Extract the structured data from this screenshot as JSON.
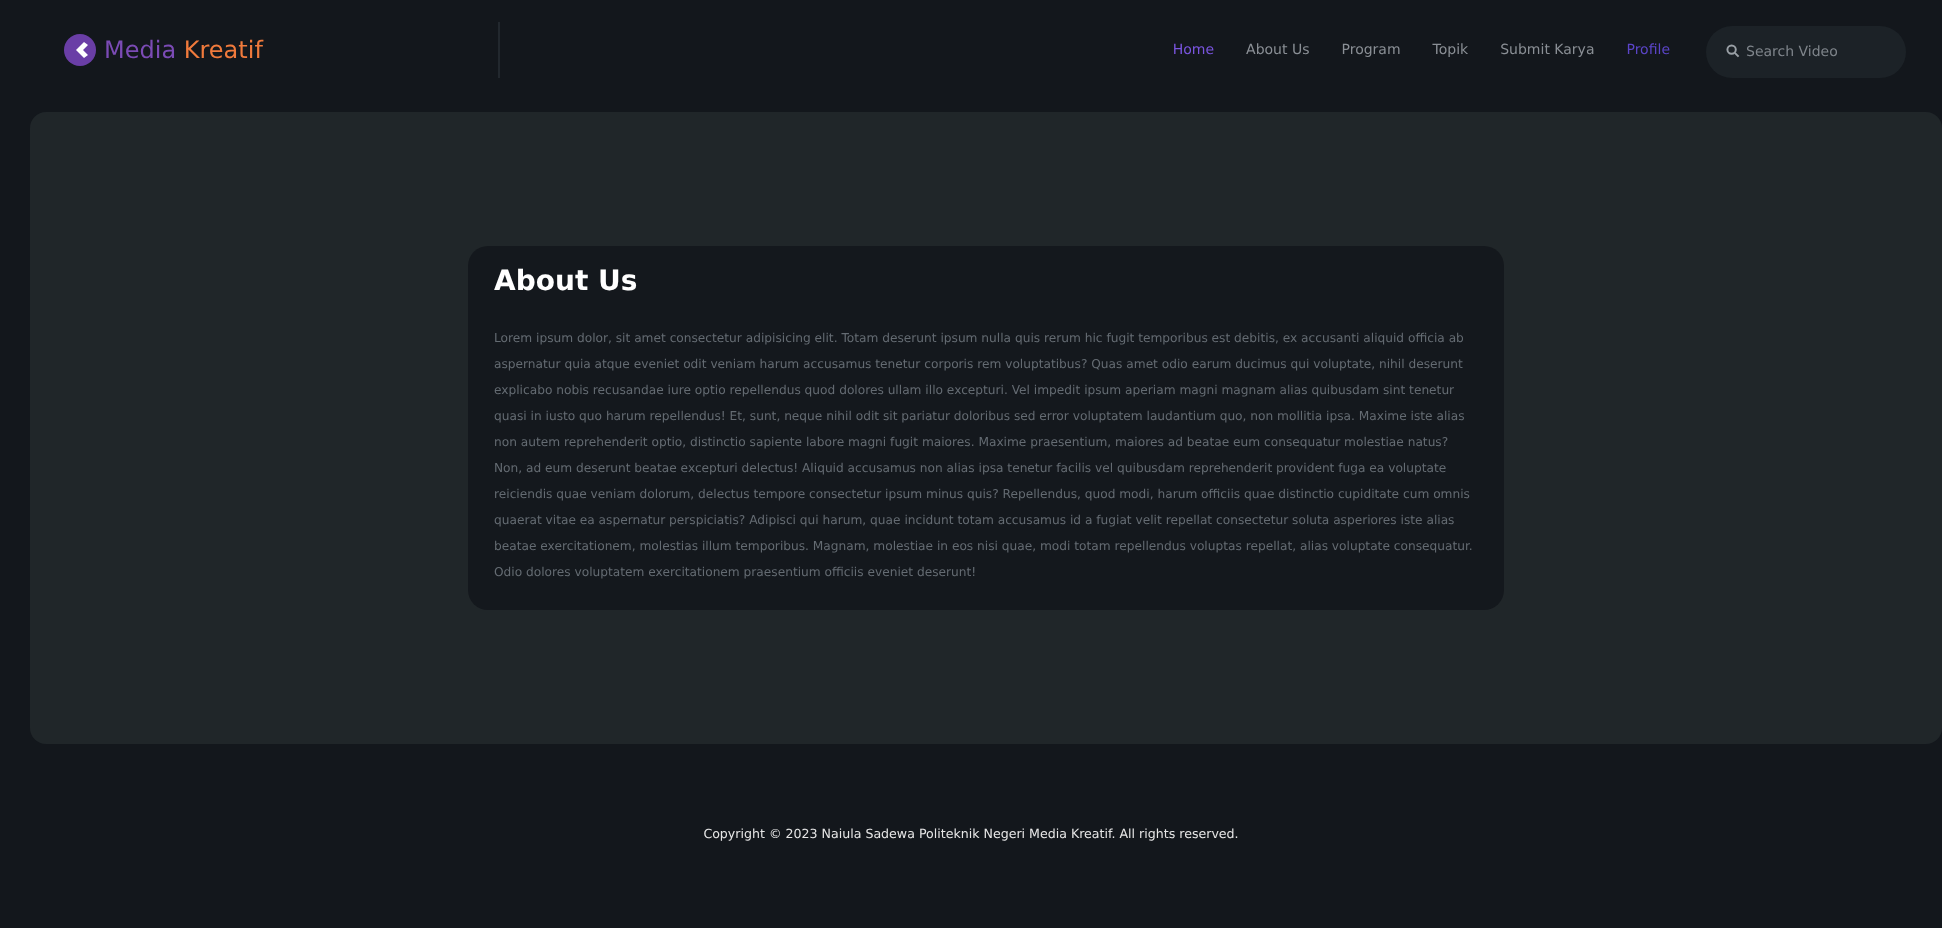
{
  "brand": {
    "first": "Media",
    "second": "Kreatif"
  },
  "nav": [
    {
      "label": "Home",
      "selected": true,
      "kind": "link"
    },
    {
      "label": "About Us",
      "selected": false,
      "kind": "link"
    },
    {
      "label": "Program",
      "selected": false,
      "kind": "link"
    },
    {
      "label": "Topik",
      "selected": false,
      "kind": "link"
    },
    {
      "label": "Submit Karya",
      "selected": false,
      "kind": "link"
    },
    {
      "label": "Profile",
      "selected": false,
      "kind": "accent"
    }
  ],
  "search": {
    "placeholder": "Search Video"
  },
  "about": {
    "title": "About Us",
    "text": "Lorem ipsum dolor, sit amet consectetur adipisicing elit. Totam deserunt ipsum nulla quis rerum hic fugit temporibus est debitis, ex accusanti aliquid officia ab aspernatur quia atque eveniet odit veniam harum accusamus tenetur corporis rem voluptatibus? Quas amet odio earum ducimus qui voluptate, nihil deserunt explicabo nobis recusandae iure optio repellendus quod dolores ullam illo excepturi. Vel impedit ipsum aperiam magni magnam alias quibusdam sint tenetur quasi in iusto quo harum repellendus! Et, sunt, neque nihil odit sit pariatur doloribus sed error voluptatem laudantium quo, non mollitia ipsa. Maxime iste alias non autem reprehenderit optio, distinctio sapiente labore magni fugit maiores. Maxime praesentium, maiores ad beatae eum consequatur molestiae natus? Non, ad eum deserunt beatae excepturi delectus! Aliquid accusamus non alias ipsa tenetur facilis vel quibusdam reprehenderit provident fuga ea voluptate reiciendis quae veniam dolorum, delectus tempore consectetur ipsum minus quis? Repellendus, quod modi, harum officiis quae distinctio cupiditate cum omnis quaerat vitae ea aspernatur perspiciatis? Adipisci qui harum, quae incidunt totam accusamus id a fugiat velit repellat consectetur soluta asperiores iste alias beatae exercitationem, molestias illum temporibus. Magnam, molestiae in eos nisi quae, modi totam repellendus voluptas repellat, alias voluptate consequatur. Odio dolores voluptatem exercitationem praesentium officiis eveniet deserunt!"
  },
  "footer": {
    "text": "Copyright © 2023 Naiula Sadewa Politeknik Negeri Media Kreatif. All rights reserved."
  }
}
